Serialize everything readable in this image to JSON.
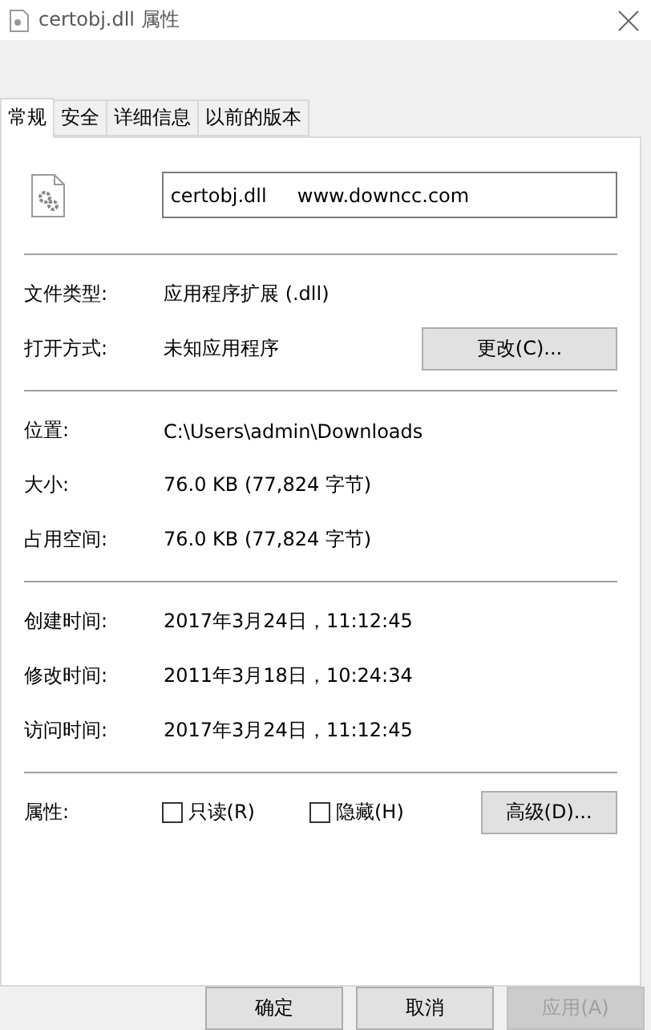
{
  "window": {
    "title": "certobj.dll 属性"
  },
  "tabs": [
    {
      "label": "常规",
      "selected": true
    },
    {
      "label": "安全",
      "selected": false
    },
    {
      "label": "详细信息",
      "selected": false
    },
    {
      "label": "以前的版本",
      "selected": false
    }
  ],
  "file_name": {
    "value": "certobj.dll     www.downcc.com"
  },
  "sections": [
    [
      {
        "label": "文件类型:",
        "value": "应用程序扩展 (.dll)"
      },
      {
        "label": "打开方式:",
        "value": "未知应用程序",
        "button": "更改(C)..."
      }
    ],
    [
      {
        "label": "位置:",
        "value": "C:\\Users\\admin\\Downloads"
      },
      {
        "label": "大小:",
        "value": "76.0 KB (77,824 字节)"
      },
      {
        "label": "占用空间:",
        "value": "76.0 KB (77,824 字节)"
      }
    ],
    [
      {
        "label": "创建时间:",
        "value": "2017年3月24日，11:12:45"
      },
      {
        "label": "修改时间:",
        "value": "2011年3月18日，10:24:34"
      },
      {
        "label": "访问时间:",
        "value": "2017年3月24日，11:12:45"
      }
    ]
  ],
  "attributes": {
    "label": "属性:",
    "checkboxes": [
      {
        "label": "只读(R)",
        "checked": false
      },
      {
        "label": "隐藏(H)",
        "checked": false
      }
    ],
    "button": "高级(D)..."
  },
  "buttons": [
    {
      "label": "确定",
      "disabled": false
    },
    {
      "label": "取消",
      "disabled": false
    },
    {
      "label": "应用(A)",
      "disabled": true
    }
  ]
}
